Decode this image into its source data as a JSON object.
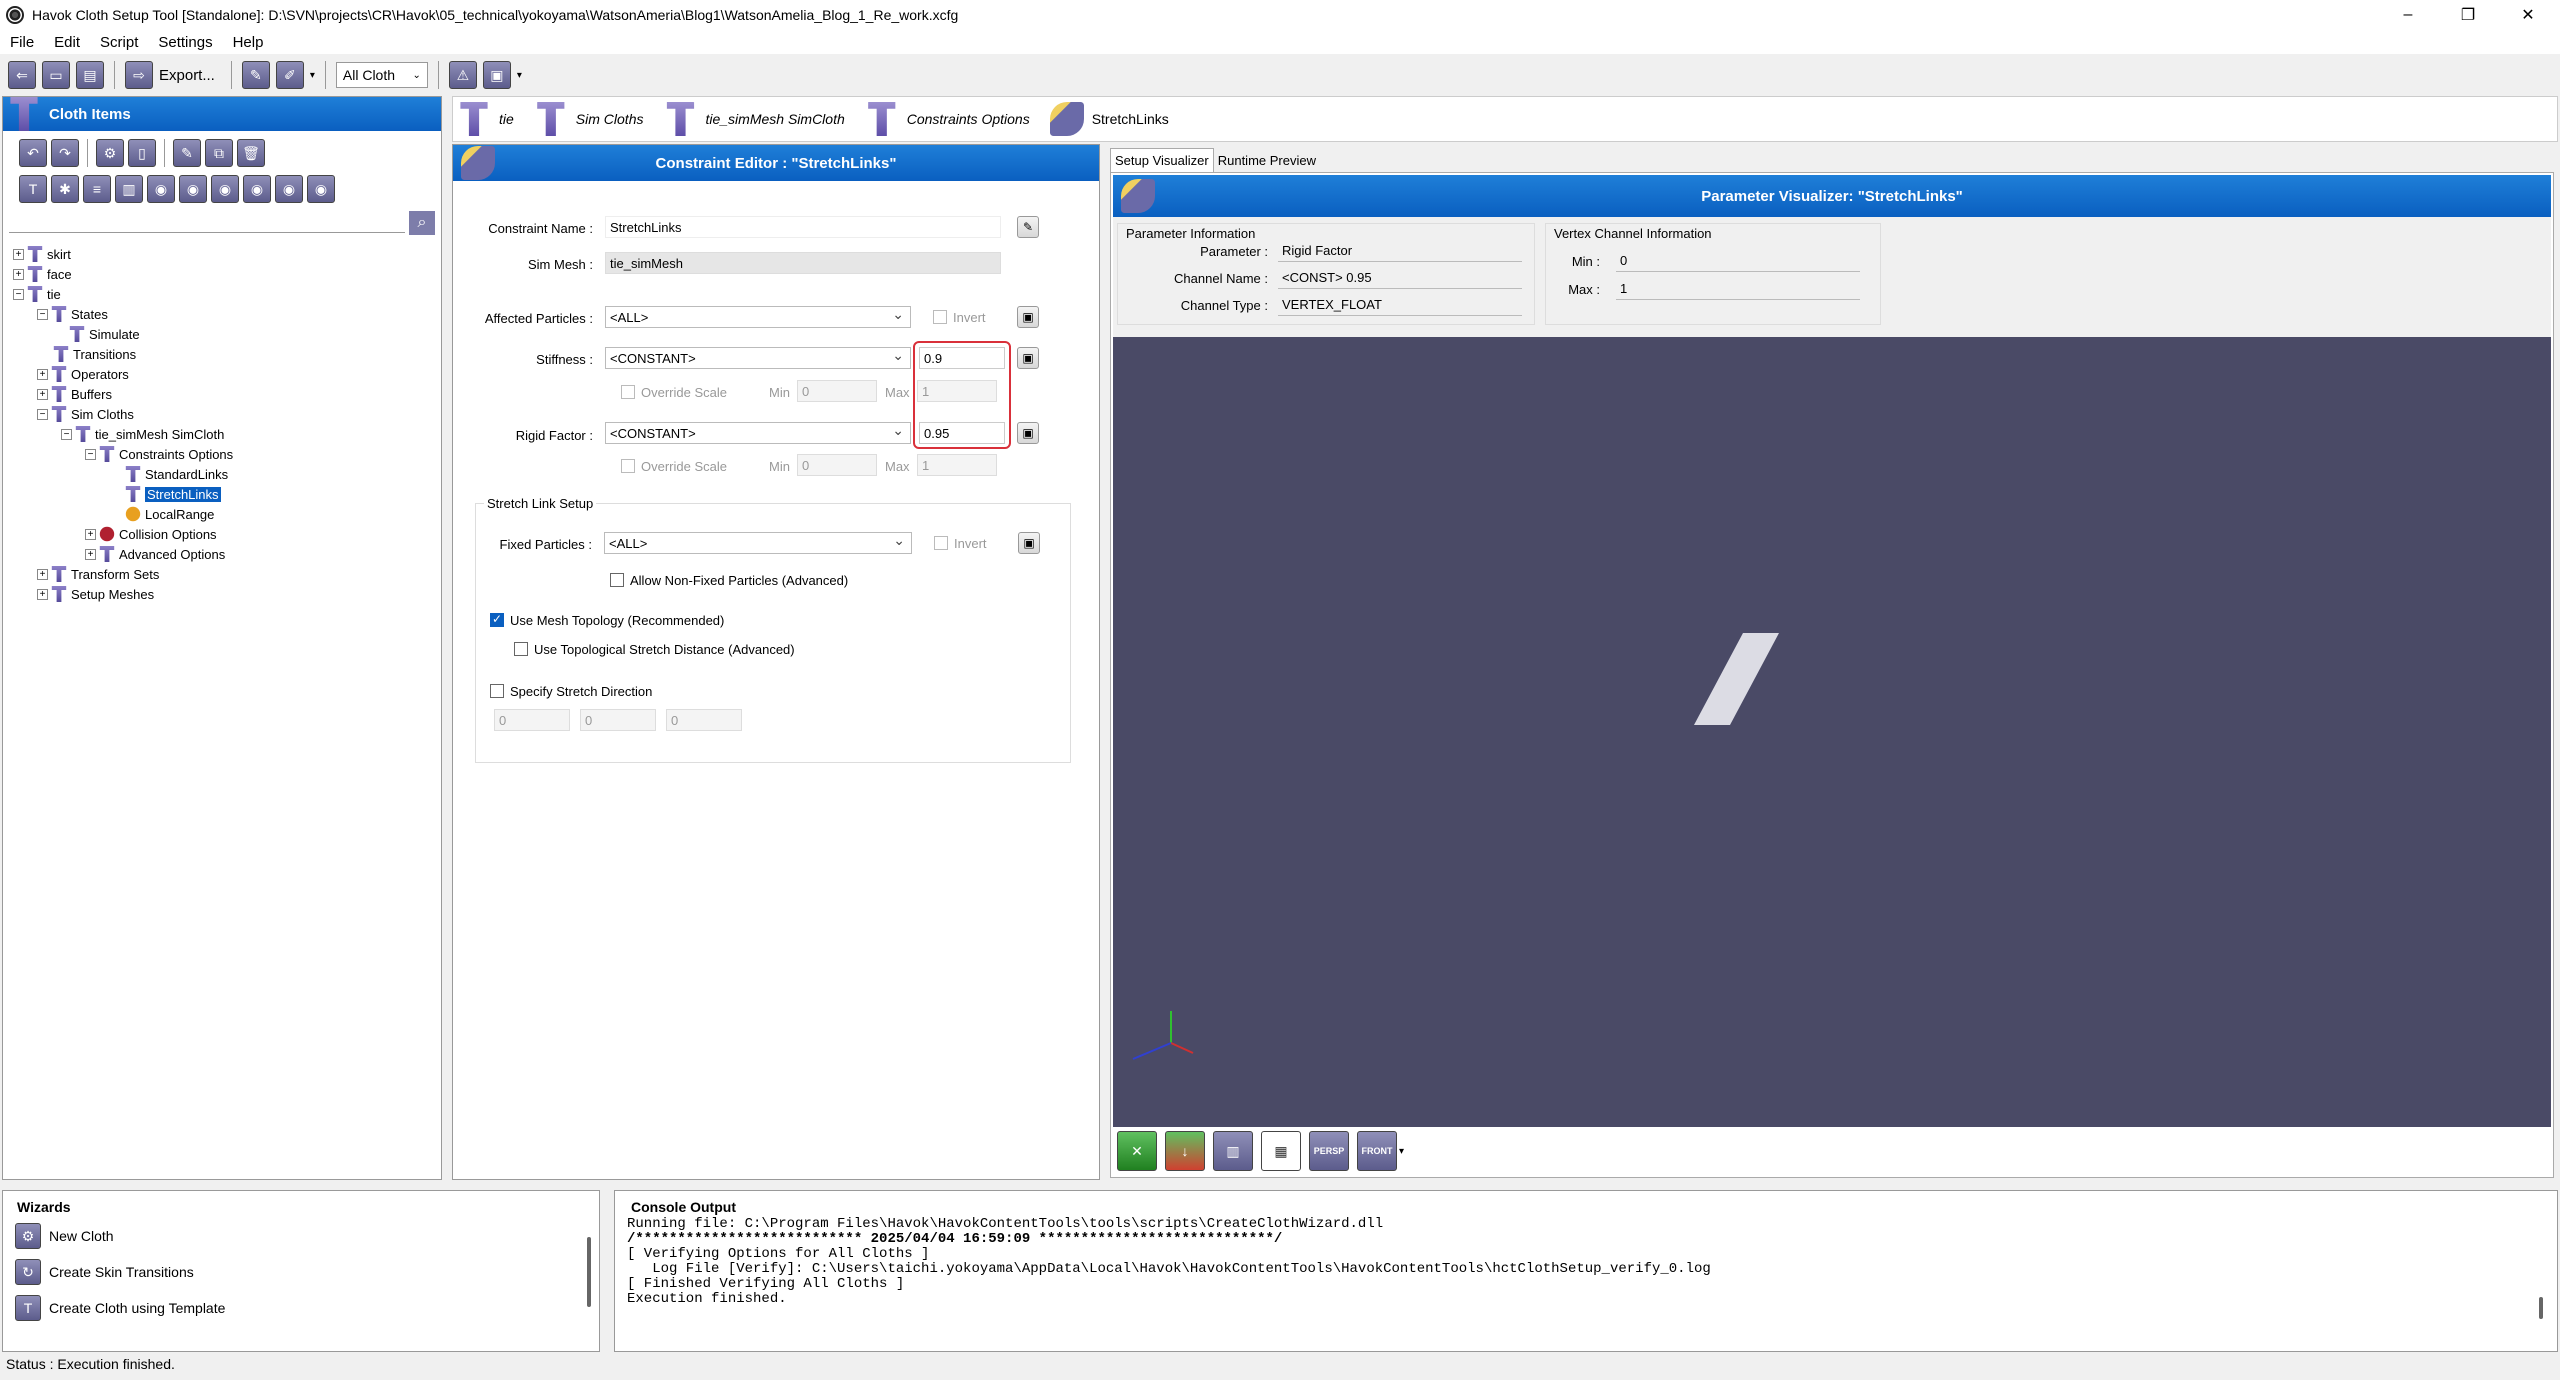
{
  "window": {
    "title": "Havok Cloth Setup Tool [Standalone]: D:\\SVN\\projects\\CR\\Havok\\05_technical\\yokoyama\\WatsonAmeria\\Blog1\\WatsonAmelia_Blog_1_Re_work.xcfg",
    "min": "–",
    "max": "❐",
    "close": "✕"
  },
  "menu": [
    "File",
    "Edit",
    "Script",
    "Settings",
    "Help"
  ],
  "toolbar": {
    "export_label": "Export...",
    "filter_value": "All Cloth"
  },
  "cloth_items": {
    "title": "Cloth Items",
    "tree": [
      {
        "label": "skirt"
      },
      {
        "label": "face"
      },
      {
        "label": "tie"
      },
      {
        "label": "States"
      },
      {
        "label": "Simulate"
      },
      {
        "label": "Transitions"
      },
      {
        "label": "Operators"
      },
      {
        "label": "Buffers"
      },
      {
        "label": "Sim Cloths"
      },
      {
        "label": "tie_simMesh SimCloth"
      },
      {
        "label": "Constraints Options"
      },
      {
        "label": "StandardLinks"
      },
      {
        "label": "StretchLinks"
      },
      {
        "label": "LocalRange"
      },
      {
        "label": "Collision Options"
      },
      {
        "label": "Advanced Options"
      },
      {
        "label": "Transform Sets"
      },
      {
        "label": "Setup Meshes"
      }
    ]
  },
  "breadcrumb": [
    "tie",
    "Sim Cloths",
    "tie_simMesh SimCloth",
    "Constraints Options",
    "StretchLinks"
  ],
  "editor": {
    "title": "Constraint Editor : \"StretchLinks\"",
    "constraint_name_label": "Constraint Name :",
    "constraint_name": "StretchLinks",
    "sim_mesh_label": "Sim Mesh :",
    "sim_mesh": "tie_simMesh",
    "affected_label": "Affected Particles :",
    "affected": "<ALL>",
    "invert_label": "Invert",
    "stiffness_label": "Stiffness :",
    "stiffness_mode": "<CONSTANT>",
    "stiffness_value": "0.9",
    "override_label": "Override Scale",
    "min_label": "Min",
    "min_value": "0",
    "max_label": "Max",
    "max_value": "1",
    "rigid_label": "Rigid Factor :",
    "rigid_mode": "<CONSTANT>",
    "rigid_value": "0.95",
    "group_title": "Stretch Link Setup",
    "fixed_label": "Fixed Particles :",
    "fixed": "<ALL>",
    "allow_label": "Allow Non-Fixed Particles (Advanced)",
    "use_mesh_label": "Use Mesh Topology (Recommended)",
    "use_topo_label": "Use Topological Stretch Distance (Advanced)",
    "specify_label": "Specify Stretch Direction",
    "dir": [
      "0",
      "0",
      "0"
    ]
  },
  "visualizer": {
    "tabs": [
      "Setup Visualizer",
      "Runtime Preview"
    ],
    "title": "Parameter Visualizer: \"StretchLinks\"",
    "param_group": "Parameter Information",
    "parameter_label": "Parameter :",
    "parameter": "Rigid Factor",
    "channel_name_label": "Channel Name :",
    "channel_name": "<CONST> 0.95",
    "channel_type_label": "Channel Type :",
    "channel_type": "VERTEX_FLOAT",
    "vertex_group": "Vertex Channel Information",
    "min_label": "Min :",
    "min": "0",
    "max_label": "Max :",
    "max": "1",
    "viewport_bg": "#4a4a66",
    "persp_label": "PERSP",
    "front_label": "FRONT"
  },
  "wizards": {
    "title": "Wizards",
    "items": [
      "New Cloth",
      "Create Skin Transitions",
      "Create Cloth using Template"
    ]
  },
  "console": {
    "title": "Console Output",
    "lines": [
      "Running file: C:\\Program Files\\Havok\\HavokContentTools\\tools\\scripts\\CreateClothWizard.dll",
      "/*************************** 2025/04/04 16:59:09 ****************************/",
      "[ Verifying Options for All Cloths ]",
      "   Log File [Verify]: C:\\Users\\taichi.yokoyama\\AppData\\Local\\Havok\\HavokContentTools\\HavokContentTools\\hctClothSetup_verify_0.log",
      "[ Finished Verifying All Cloths ]",
      "Execution finished."
    ]
  },
  "status": "Status : Execution finished."
}
